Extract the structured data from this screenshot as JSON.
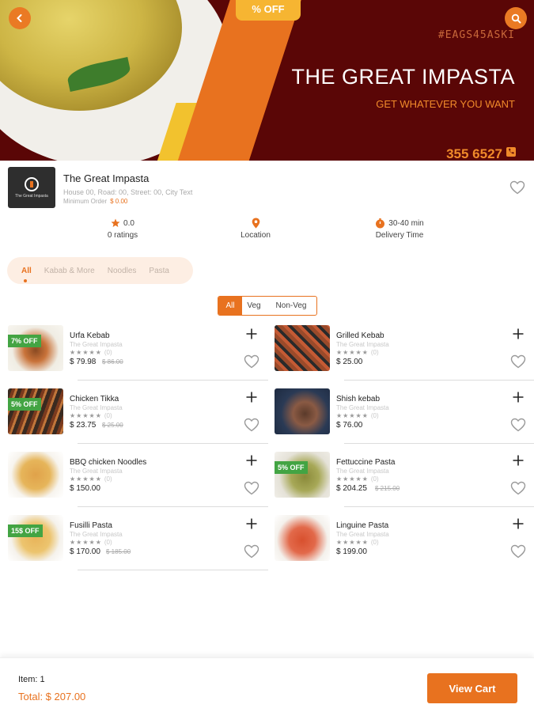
{
  "banner": {
    "discount_badge": "% OFF",
    "promo_code": "#EAGS45ASKI",
    "title": "THE GREAT IMPASTA",
    "subtitle": "GET WHATEVER YOU WANT",
    "phone": "355 6527"
  },
  "restaurant": {
    "name": "The Great Impasta",
    "address": "House 00, Road: 00, Street: 00, City Text",
    "min_order_label": "Minimum Order",
    "min_order_value": "$ 0.00"
  },
  "stats": {
    "rating_value": "0.0",
    "rating_label": "0 ratings",
    "location_label": "Location",
    "delivery_value": "30-40 min",
    "delivery_label": "Delivery Time"
  },
  "categories": [
    "All",
    "Kabab & More",
    "Noodles",
    "Pasta"
  ],
  "veg_filter": [
    "All",
    "Veg",
    "Non-Veg"
  ],
  "menu": [
    {
      "name": "Urfa Kebab",
      "restaurant": "The Great Impasta",
      "stars": "★★★★★",
      "rating_count": "(0)",
      "price": "$ 79.98",
      "old_price": "$ 86.00",
      "discount": "7% OFF"
    },
    {
      "name": "Grilled Kebab",
      "restaurant": "The Great Impasta",
      "stars": "★★★★★",
      "rating_count": "(0)",
      "price": "$ 25.00",
      "old_price": "",
      "discount": ""
    },
    {
      "name": "Chicken Tikka",
      "restaurant": "The Great Impasta",
      "stars": "★★★★★",
      "rating_count": "(0)",
      "price": "$ 23.75",
      "old_price": "$ 25.00",
      "discount": "5% OFF"
    },
    {
      "name": "Shish kebab",
      "restaurant": "The Great Impasta",
      "stars": "★★★★★",
      "rating_count": "(0)",
      "price": "$ 76.00",
      "old_price": "",
      "discount": ""
    },
    {
      "name": "BBQ chicken Noodles",
      "restaurant": "The Great Impasta",
      "stars": "★★★★★",
      "rating_count": "(0)",
      "price": "$ 150.00",
      "old_price": "",
      "discount": ""
    },
    {
      "name": "Fettuccine Pasta",
      "restaurant": "The Great Impasta",
      "stars": "★★★★★",
      "rating_count": "(0)",
      "price": "$ 204.25",
      "old_price": "$ 215.00",
      "discount": "5% OFF"
    },
    {
      "name": "Fusilli Pasta",
      "restaurant": "The Great Impasta",
      "stars": "★★★★★",
      "rating_count": "(0)",
      "price": "$ 170.00",
      "old_price": "$ 185.00",
      "discount": "15$ OFF"
    },
    {
      "name": "Linguine Pasta",
      "restaurant": "The Great Impasta",
      "stars": "★★★★★",
      "rating_count": "(0)",
      "price": "$ 199.00",
      "old_price": "",
      "discount": ""
    }
  ],
  "cart": {
    "item_count": "Item: 1",
    "total": "Total: $ 207.00",
    "view_cart_label": "View Cart"
  },
  "icons": {
    "back": "back-arrow-icon",
    "search": "search-icon",
    "phone": "phone-icon",
    "favorite": "heart-icon",
    "add": "plus-icon",
    "rating": "star-icon",
    "location": "location-pin-icon",
    "delivery": "timer-icon"
  },
  "colors": {
    "accent": "#e8721f",
    "banner_bg": "#5a0606",
    "discount_badge": "#43a443"
  }
}
